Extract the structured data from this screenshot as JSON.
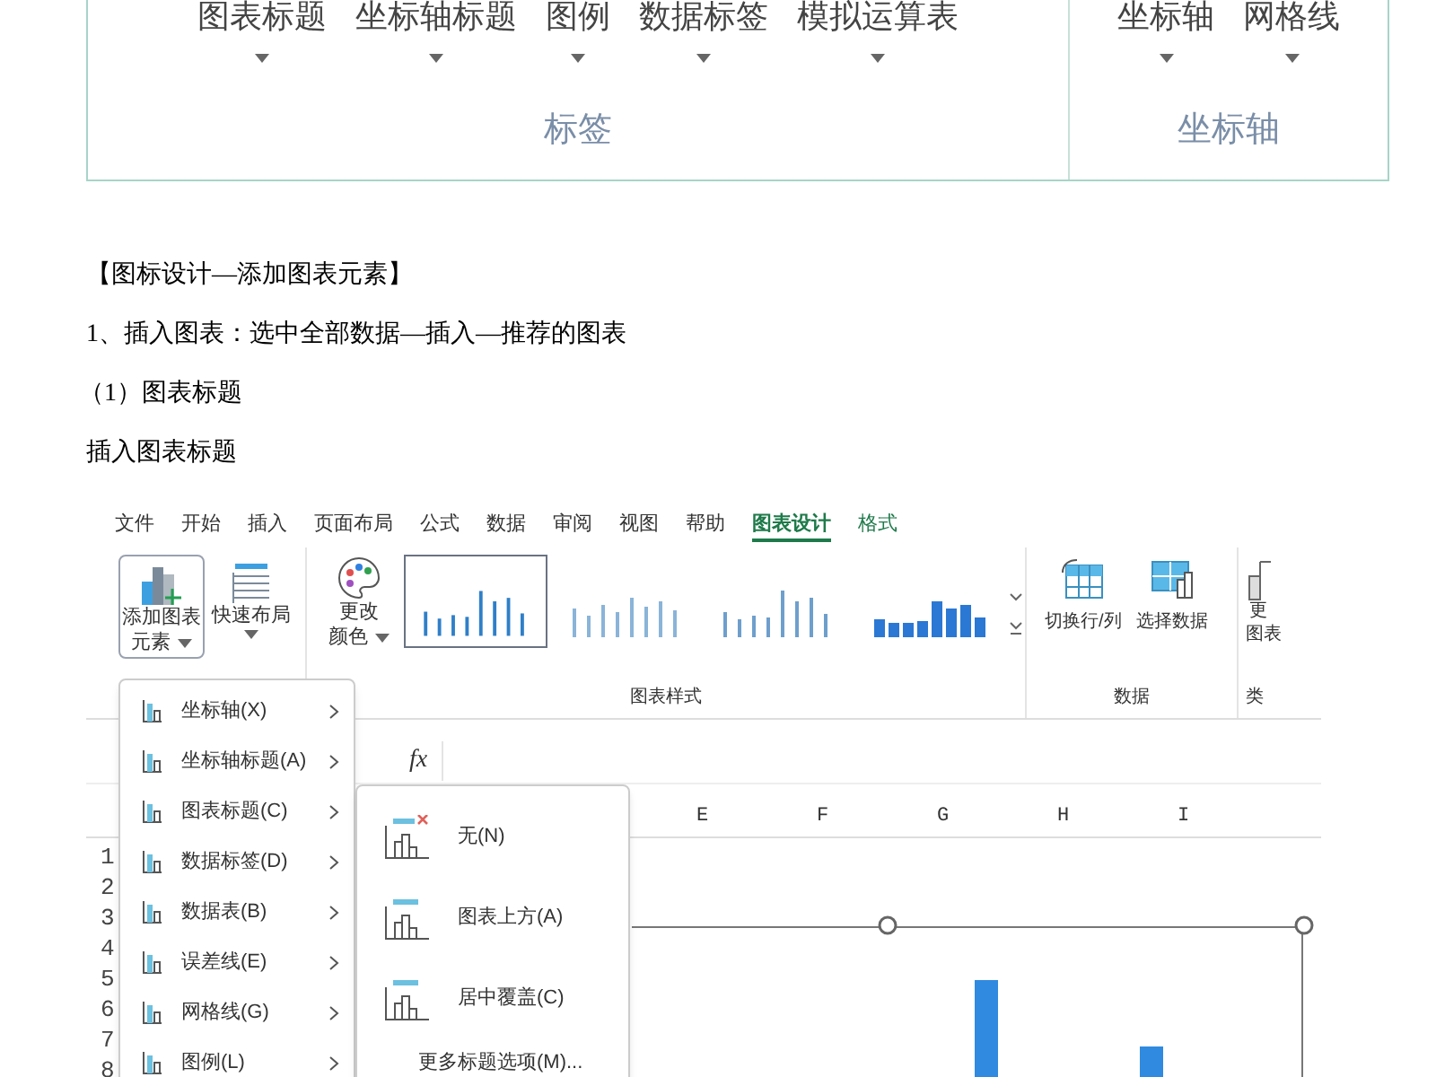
{
  "top_ribbon": {
    "groups": [
      {
        "label": "标签",
        "buttons": [
          "图表标题",
          "坐标轴标题",
          "图例",
          "数据标签",
          "模拟运算表"
        ]
      },
      {
        "label": "坐标轴",
        "buttons": [
          "坐标轴",
          "网格线"
        ]
      }
    ]
  },
  "paragraphs": [
    "【图标设计—添加图表元素】",
    "1、插入图表：选中全部数据—插入—推荐的图表",
    "（1）图表标题",
    "插入图表标题"
  ],
  "excel": {
    "tabs": [
      {
        "label": "文件",
        "selected": false,
        "contextual": false
      },
      {
        "label": "开始",
        "selected": false,
        "contextual": false
      },
      {
        "label": "插入",
        "selected": false,
        "contextual": false
      },
      {
        "label": "页面布局",
        "selected": false,
        "contextual": false
      },
      {
        "label": "公式",
        "selected": false,
        "contextual": false
      },
      {
        "label": "数据",
        "selected": false,
        "contextual": false
      },
      {
        "label": "审阅",
        "selected": false,
        "contextual": false
      },
      {
        "label": "视图",
        "selected": false,
        "contextual": false
      },
      {
        "label": "帮助",
        "selected": false,
        "contextual": false
      },
      {
        "label": "图表设计",
        "selected": true,
        "contextual": true
      },
      {
        "label": "格式",
        "selected": false,
        "contextual": true
      }
    ],
    "ribbon": {
      "add_element": [
        "添加图表",
        "元素"
      ],
      "quick_layout": "快速布局",
      "change_colors": [
        "更改",
        "颜色"
      ],
      "styles_label": "图表样式",
      "switch": "切换行/列",
      "select_data": "选择数据",
      "data_label": "数据",
      "change_type": [
        "更",
        "图表"
      ],
      "type_label": "类"
    },
    "formula_bar": {
      "fx": "fx"
    },
    "columns": [
      "E",
      "F",
      "G",
      "H",
      "I"
    ],
    "rows": [
      "1",
      "2",
      "3",
      "4",
      "5",
      "6",
      "7",
      "8"
    ],
    "menu": [
      {
        "label": "坐标轴(X)"
      },
      {
        "label": "坐标轴标题(A)"
      },
      {
        "label": "图表标题(C)"
      },
      {
        "label": "数据标签(D)"
      },
      {
        "label": "数据表(B)"
      },
      {
        "label": "误差线(E)"
      },
      {
        "label": "网格线(G)"
      },
      {
        "label": "图例(L)"
      }
    ],
    "submenu": {
      "items": [
        {
          "label": "无(N)",
          "kind": "none"
        },
        {
          "label": "图表上方(A)",
          "kind": "above"
        },
        {
          "label": "居中覆盖(C)",
          "kind": "overlay"
        }
      ],
      "more": "更多标题选项(M)..."
    }
  }
}
